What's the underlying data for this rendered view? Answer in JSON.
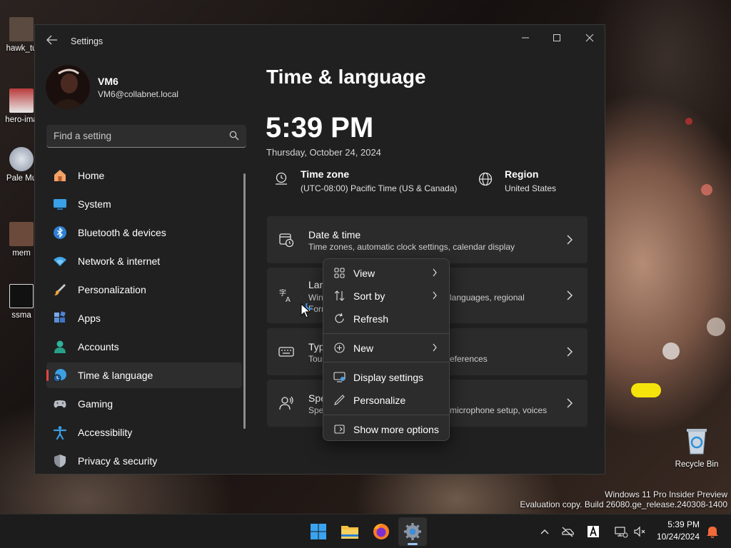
{
  "desktop": {
    "icons": [
      {
        "label": "hawk_tu"
      },
      {
        "label": "hero-ima"
      },
      {
        "label": "Pale Mu"
      },
      {
        "label": "mem"
      },
      {
        "label": "ssma"
      },
      {
        "label": "Recycle Bin"
      }
    ],
    "watermark": {
      "line1": "Windows 11 Pro Insider Preview",
      "line2": "Evaluation copy. Build 26080.ge_release.240308-1400"
    }
  },
  "window": {
    "title": "Settings",
    "back_icon": "back-arrow-icon"
  },
  "profile": {
    "name": "VM6",
    "email": "VM6@collabnet.local"
  },
  "search": {
    "placeholder": "Find a setting"
  },
  "nav": [
    {
      "label": "Home",
      "icon": "home-icon"
    },
    {
      "label": "System",
      "icon": "system-icon"
    },
    {
      "label": "Bluetooth & devices",
      "icon": "bluetooth-icon"
    },
    {
      "label": "Network & internet",
      "icon": "wifi-icon"
    },
    {
      "label": "Personalization",
      "icon": "brush-icon"
    },
    {
      "label": "Apps",
      "icon": "apps-icon"
    },
    {
      "label": "Accounts",
      "icon": "account-icon"
    },
    {
      "label": "Time & language",
      "icon": "globe-clock-icon",
      "active": true
    },
    {
      "label": "Gaming",
      "icon": "gamepad-icon"
    },
    {
      "label": "Accessibility",
      "icon": "accessibility-icon"
    },
    {
      "label": "Privacy & security",
      "icon": "shield-icon"
    }
  ],
  "main": {
    "title": "Time & language",
    "time": "5:39 PM",
    "date": "Thursday, October 24, 2024",
    "time_zone": {
      "title": "Time zone",
      "value": "(UTC-08:00) Pacific Time (US & Canada)"
    },
    "region": {
      "title": "Region",
      "value": "United States"
    },
    "cards": [
      {
        "title": "Date & time",
        "subtitle": "Time zones, automatic clock settings, calendar display"
      },
      {
        "title": "Lan",
        "subtitle": "Win",
        "subtitle2": "Form",
        "subtitle_right": "languages, regional"
      },
      {
        "title": "Typ",
        "subtitle": "Tou",
        "subtitle_right": "eferences"
      },
      {
        "title": "Spe",
        "subtitle": "Spe",
        "subtitle_right": "microphone setup, voices"
      }
    ]
  },
  "context_menu": {
    "items": [
      {
        "label": "View",
        "submenu": true
      },
      {
        "label": "Sort by",
        "submenu": true
      },
      {
        "label": "Refresh",
        "submenu": false
      },
      {
        "label": "New",
        "submenu": true
      },
      {
        "label": "Display settings",
        "submenu": false
      },
      {
        "label": "Personalize",
        "submenu": false
      },
      {
        "label": "Show more options",
        "submenu": false
      }
    ]
  },
  "taskbar": {
    "apps": [
      "start-icon",
      "file-explorer-icon",
      "firefox-icon",
      "settings-icon"
    ],
    "active_app": "settings-icon",
    "tray_time": "5:39 PM",
    "tray_date": "10/24/2024"
  },
  "colors": {
    "accent_red": "#e5443f",
    "window_bg": "#202020",
    "card_bg": "#2b2b2b",
    "menu_bg": "#2c2c2c"
  }
}
